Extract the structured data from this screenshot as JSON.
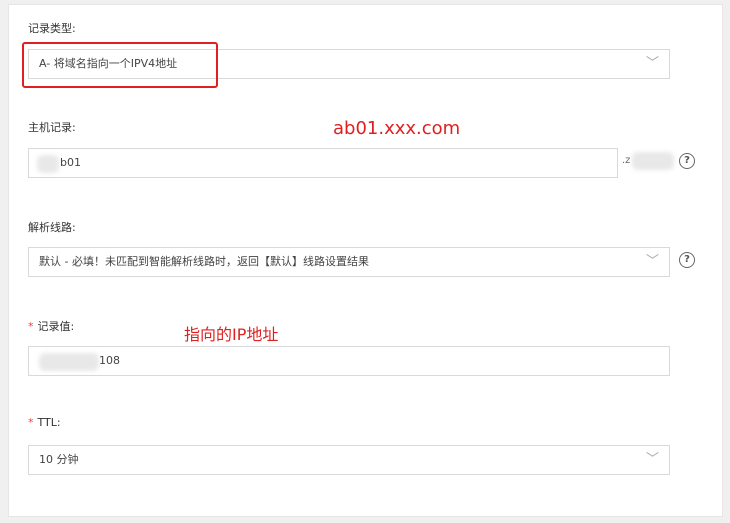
{
  "record_type": {
    "label": "记录类型:",
    "value": "A- 将域名指向一个IPV4地址"
  },
  "host_record": {
    "label": "主机记录:",
    "value": "b01",
    "suffix": ".z",
    "annotation": "ab01.xxx.com"
  },
  "resolve_line": {
    "label": "解析线路:",
    "value": "默认 - 必填！未匹配到智能解析线路时，返回【默认】线路设置结果"
  },
  "record_value": {
    "required_mark": "*",
    "label": "记录值:",
    "value": "108",
    "annotation": "指向的IP地址"
  },
  "ttl": {
    "required_mark": "*",
    "label": "TTL:",
    "value": "10 分钟"
  },
  "icons": {
    "chevron": "chevron-down-icon",
    "help": "help-circle-icon"
  },
  "colors": {
    "annotation": "#e02020",
    "required": "#e54545",
    "border": "#d9d9d9"
  }
}
